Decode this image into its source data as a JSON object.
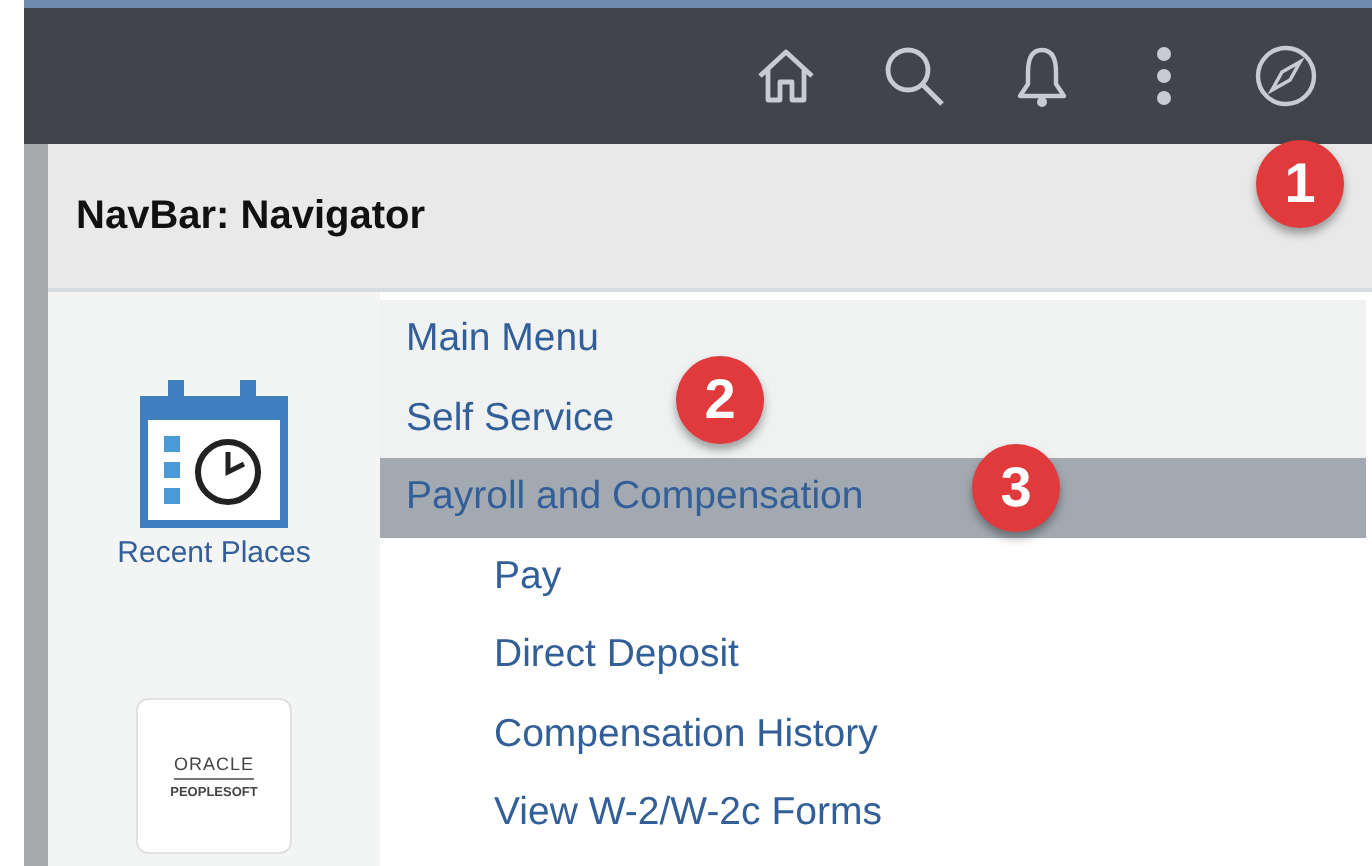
{
  "header": {
    "title": "NavBar: Navigator"
  },
  "recent_places": {
    "label": "Recent Places"
  },
  "logo": {
    "brand": "ORACLE",
    "product": "PEOPLESOFT"
  },
  "menu": [
    {
      "label": "Main Menu",
      "selected": false
    },
    {
      "label": "Self Service",
      "selected": false
    },
    {
      "label": "Payroll and Compensation",
      "selected": true,
      "children": [
        {
          "label": "Pay"
        },
        {
          "label": "Direct Deposit"
        },
        {
          "label": "Compensation History"
        },
        {
          "label": "View W-2/W-2c Forms"
        }
      ]
    }
  ],
  "callouts": [
    "1",
    "2",
    "3"
  ]
}
